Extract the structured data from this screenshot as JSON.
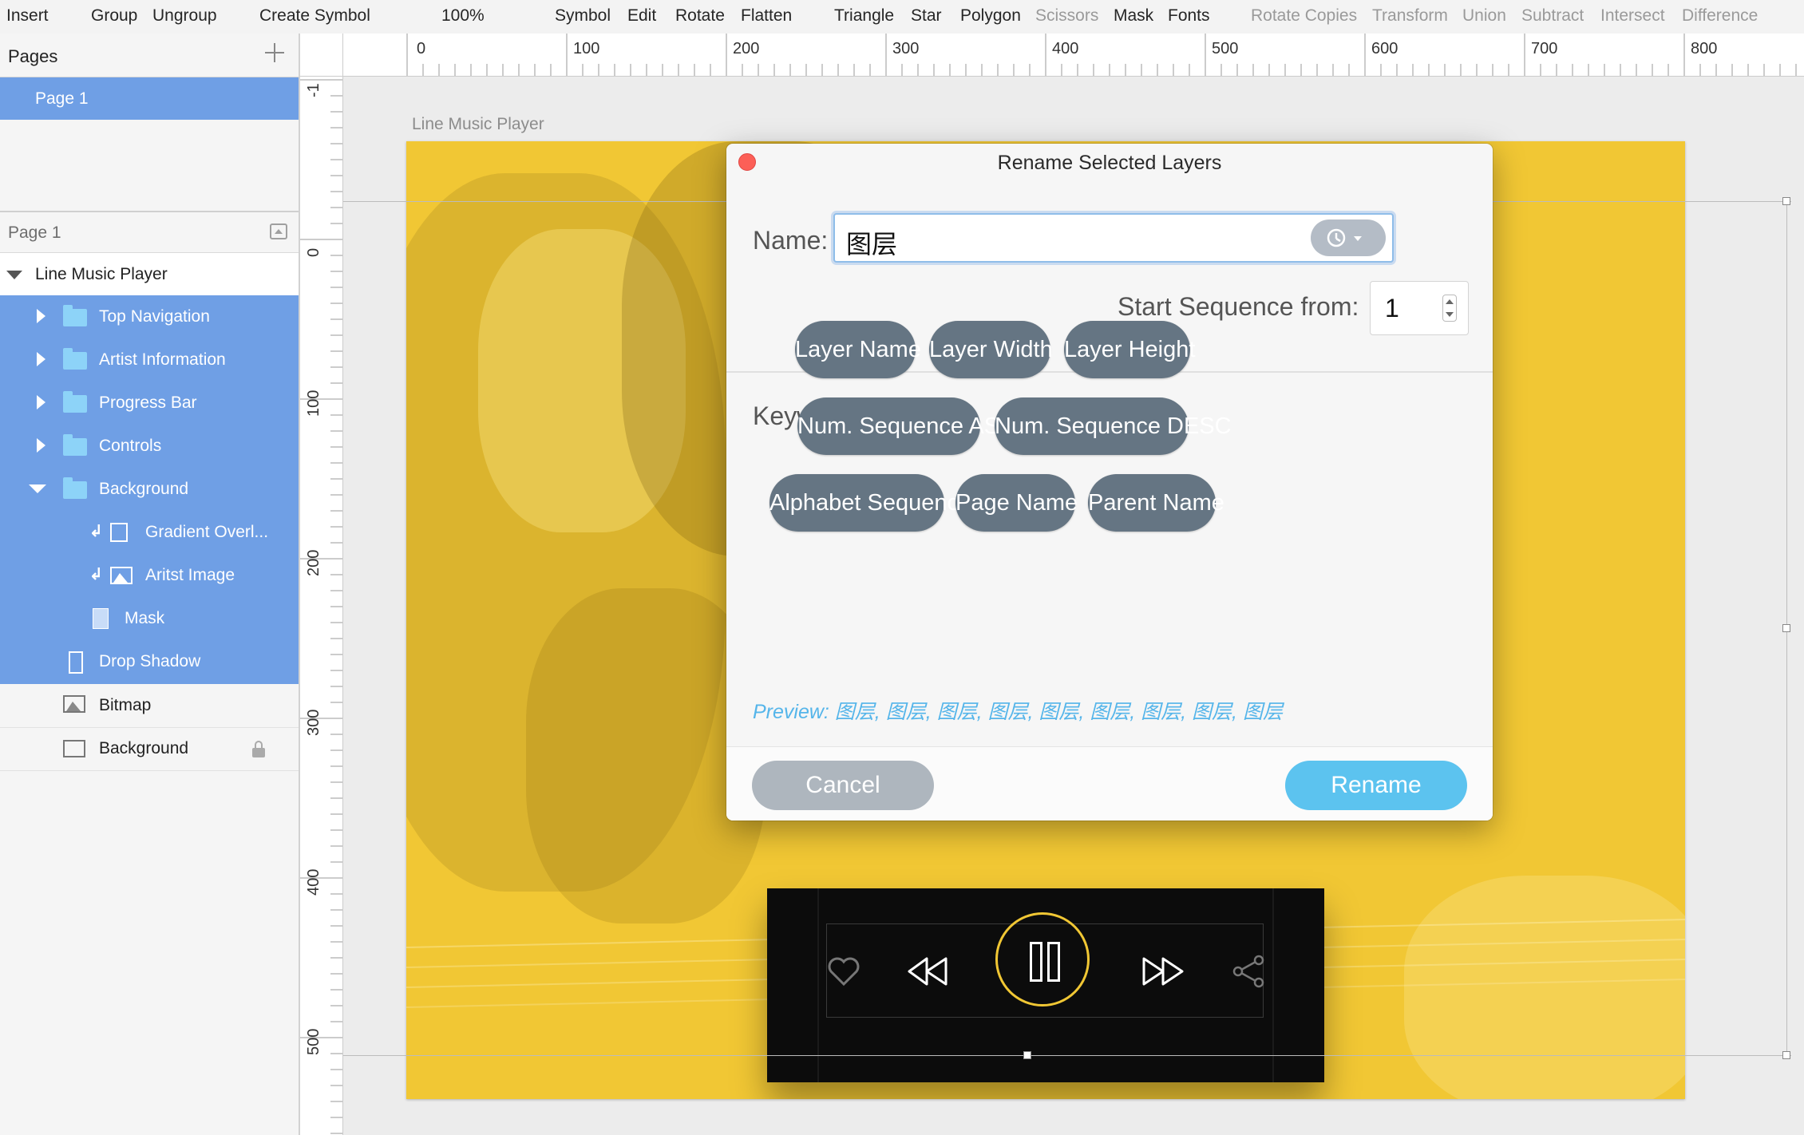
{
  "toolbar": {
    "items": [
      "Insert",
      "Group",
      "Ungroup",
      "Create Symbol",
      "100%",
      "Symbol",
      "Edit",
      "Rotate",
      "Flatten",
      "Triangle",
      "Star",
      "Polygon",
      "Scissors",
      "Mask",
      "Fonts",
      "Rotate Copies",
      "Transform",
      "Union",
      "Subtract",
      "Intersect",
      "Difference"
    ]
  },
  "sidebar": {
    "pages_title": "Pages",
    "pages": [
      "Page 1"
    ],
    "current_page_header": "Page 1",
    "artboard": "Line Music Player",
    "layers": [
      "Top Navigation",
      "Artist Information",
      "Progress Bar",
      "Controls",
      "Background",
      "Gradient Overl...",
      "Aritst Image",
      "Mask",
      "Drop Shadow",
      "Bitmap",
      "Background"
    ]
  },
  "rulers": {
    "horizontal": [
      "0",
      "100",
      "200",
      "300",
      "400",
      "500",
      "600",
      "700",
      "800"
    ],
    "vertical": [
      "-1",
      "0",
      "100",
      "200",
      "300",
      "400",
      "500"
    ]
  },
  "canvas": {
    "artboard_title": "Line Music Player",
    "accent_color": "#f1c734"
  },
  "dialog": {
    "title": "Rename Selected Layers",
    "name_label": "Name:",
    "name_value": "图层",
    "seq_label": "Start Sequence from:",
    "seq_value": "1",
    "keywords_title": "Keywords",
    "keywords": [
      "Layer Name",
      "Layer Width",
      "Layer Height",
      "Num. Sequence ASC",
      "Num. Sequence DESC",
      "Alphabet Sequence",
      "Page Name",
      "Parent Name"
    ],
    "preview": "Preview: 图层, 图层, 图层, 图层, 图层, 图层, 图层, 图层, 图层",
    "cancel": "Cancel",
    "rename": "Rename",
    "colors": {
      "close": "#fc5f57",
      "keyword": "#657583",
      "rename": "#5cc3ef",
      "cancel": "#aeb6be",
      "preview": "#55b5ea"
    }
  }
}
